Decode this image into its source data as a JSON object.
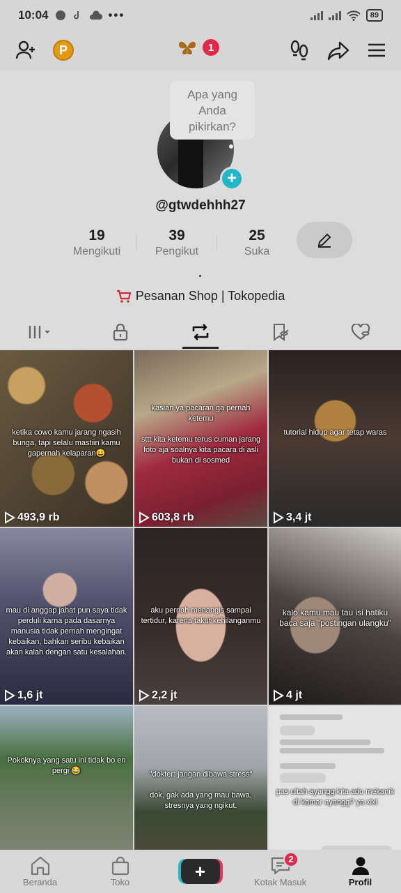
{
  "status_bar": {
    "time": "10:04",
    "battery": "89"
  },
  "topbar": {
    "coin_letter": "P",
    "notification_count": "1"
  },
  "profile": {
    "bubble_text": "Apa yang Anda pikirkan?",
    "username": "@gtwdehhh27",
    "stats": [
      {
        "value": "19",
        "label": "Mengikuti"
      },
      {
        "value": "39",
        "label": "Pengikut"
      },
      {
        "value": "25",
        "label": "Suka"
      }
    ],
    "shop_link": "Pesanan Shop | Tokopedia"
  },
  "tabs": [
    "videos",
    "private",
    "reposts",
    "favorites",
    "liked"
  ],
  "active_tab": "reposts",
  "videos": [
    {
      "caption": "ketika cowo kamu jarang ngasih bunga, tapi selalu mastiin kamu gapernah kelaparan😄",
      "views": "493,9 rb"
    },
    {
      "caption": "kasian ya pacaran ga pernah ketemu\n\nsttt kita ketemu terus cuman jarang foto aja soalnya kita pacara di asli bukan di sosmed",
      "views": "603,8 rb"
    },
    {
      "caption": "tutorial hidup agar tetap waras",
      "views": "3,4 jt"
    },
    {
      "caption": "mau di anggap jahat pun saya tidak perduli karna pada dasarnya manusia tidak pernah mengingat kebaikan, bahkan seribu kebaikan akan kalah dengan satu kesalahan.",
      "views": "1,6 jt"
    },
    {
      "caption": "aku pernah menangis sampai tertidur, karena takut kehilanganmu",
      "views": "2,2 jt"
    },
    {
      "caption": "kalo kamu mau tau isi hatiku baca saja \"postingan ulangku\"",
      "views": "4 jt"
    },
    {
      "caption": "Pokoknya yang satu ini tidak bo en pergi 😂",
      "views": ""
    },
    {
      "caption": "\"dokter: jangan dibawa stress\"\n\ndok, gak ada yang mau bawa, stresnya yang ngikut.",
      "views": ""
    },
    {
      "caption": "pas ultah ayangg kita adu mekanik di kamar ayangg? ya xixi",
      "views": ""
    }
  ],
  "bottom_nav": [
    {
      "label": "Beranda"
    },
    {
      "label": "Toko"
    },
    {
      "label": ""
    },
    {
      "label": "Kotak Masuk",
      "badge": "2"
    },
    {
      "label": "Profil"
    }
  ]
}
